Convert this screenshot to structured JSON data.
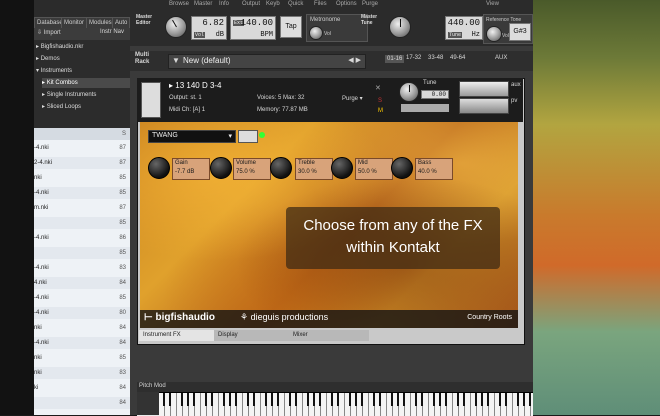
{
  "menu": [
    "Browse",
    "Master",
    "Info",
    "Output",
    "Keyb",
    "Quick",
    "Files",
    "Options",
    "Purge",
    "View"
  ],
  "browser_tabs": [
    "Database",
    "Monitor",
    "Modules",
    "Auto"
  ],
  "browser_toolbar": {
    "import": "Import",
    "instr_nav": "Instr Nav"
  },
  "browser_tree": [
    "Bigfishaudio.nkr",
    "Demos",
    "Instruments",
    "Kit Combos",
    "Single Instruments",
    "Sliced Loops"
  ],
  "master_editor": {
    "label": "Master Editor",
    "vol_value": "6.82",
    "vol_unit": "dB",
    "vol_tag": "Vol",
    "bpm_value": "140.00",
    "bpm_unit": "BPM",
    "ext_label": "Ext",
    "tap_label": "Tap",
    "metronome": "Metronome",
    "metronome_vol": "Vol"
  },
  "master_tune": {
    "label": "Master Tune",
    "hz_value": "440.00",
    "hz_unit": "Hz",
    "tune_tag": "Tune",
    "reference_tone": "Reference Tone",
    "ref_vol": "Vol",
    "note": "G#3"
  },
  "multi_rack": {
    "label": "Multi Rack",
    "multi_name": "New (default)",
    "pages": [
      "01-16",
      "17-32",
      "33-48",
      "49-64"
    ],
    "aux": "AUX"
  },
  "instrument": {
    "name": "13 140 D 3-4",
    "output_label": "Output:",
    "output_value": "st. 1",
    "voices_label": "Voices:",
    "voices_value": "5",
    "max_label": "Max:",
    "max_value": "32",
    "purge": "Purge",
    "midi_label": "Midi Ch:",
    "midi_value": "[A] 1",
    "memory_label": "Memory:",
    "memory_value": "77.87 MB",
    "tune_label": "Tune",
    "tune_value": "0.00"
  },
  "fx": {
    "preset": "TWANG",
    "params": [
      {
        "label": "Gain",
        "value": "-7.7 dB"
      },
      {
        "label": "Volume",
        "value": "75.0 %"
      },
      {
        "label": "Treble",
        "value": "30.0 %"
      },
      {
        "label": "Mid",
        "value": "50.0 %"
      },
      {
        "label": "Bass",
        "value": "40.0 %"
      }
    ]
  },
  "caption": {
    "line1": "Choose from any of the FX",
    "line2": "within Kontakt"
  },
  "branding": {
    "left": "bigfishaudio",
    "mid": "dieguis productions",
    "right": "Country Roots"
  },
  "subtabs": [
    "Instrument FX",
    "Display",
    "Mixer"
  ],
  "pitch_mod": "Pitch Mod",
  "file_list": [
    {
      "name": "-4.nki",
      "size": "87"
    },
    {
      "name": "2-4.nki",
      "size": "87"
    },
    {
      "name": "nki",
      "size": "85"
    },
    {
      "name": "-4.nki",
      "size": "85"
    },
    {
      "name": "m.nki",
      "size": "87"
    },
    {
      "name": "",
      "size": "85"
    },
    {
      "name": "-4.nki",
      "size": "86"
    },
    {
      "name": "",
      "size": "85"
    },
    {
      "name": "-4.nki",
      "size": "83"
    },
    {
      "name": "4.nki",
      "size": "84"
    },
    {
      "name": "-4.nki",
      "size": "85"
    },
    {
      "name": "-4.nki",
      "size": "80"
    },
    {
      "name": "nki",
      "size": "84"
    },
    {
      "name": "-4.nki",
      "size": "84"
    },
    {
      "name": "nki",
      "size": "85"
    },
    {
      "name": "nki",
      "size": "83"
    },
    {
      "name": "ki",
      "size": "84"
    },
    {
      "name": "",
      "size": "84"
    }
  ],
  "file_list_header_size": "S",
  "colors": {
    "accent_orange": "#d98a2a",
    "lcd_bg": "#d9d9d9",
    "panel_dark": "#2b2b2b"
  }
}
